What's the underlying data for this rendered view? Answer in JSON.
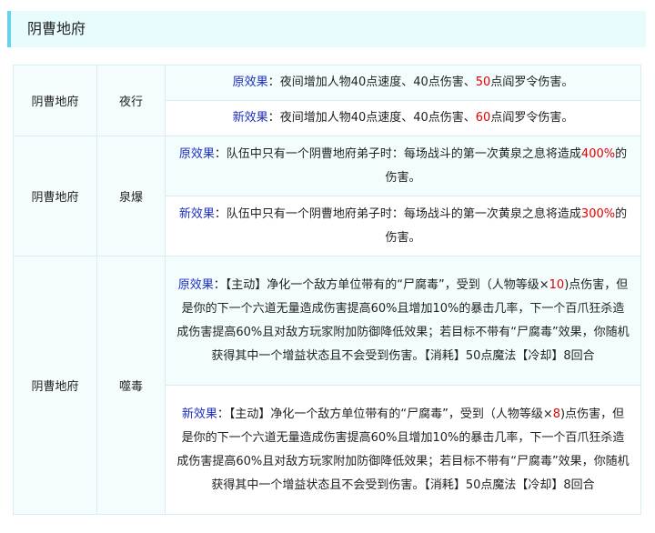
{
  "header": {
    "title": "阴曹地府"
  },
  "colors": {
    "label": "#1f2fbf",
    "highlight": "#e60000",
    "header_accent": "#6ad1ea"
  },
  "rows": [
    {
      "school": "阴曹地府",
      "skill": "夜行",
      "old": {
        "label": "原效果",
        "colon": "：",
        "text_a": "夜间增加人物40点速度、40点伤害、",
        "highlight": "50",
        "text_b": "点阎罗令伤害。"
      },
      "new": {
        "label": "新效果",
        "colon": "：",
        "text_a": "夜间增加人物40点速度、40点伤害、",
        "highlight": "60",
        "text_b": "点阎罗令伤害。"
      }
    },
    {
      "school": "阴曹地府",
      "skill": "泉爆",
      "old": {
        "label": "原效果",
        "colon": "：",
        "text_a": "队伍中只有一个阴曹地府弟子时：每场战斗的第一次黄泉之息将造成",
        "highlight": "400%",
        "text_b": "的伤害。"
      },
      "new": {
        "label": "新效果",
        "colon": "：",
        "text_a": "队伍中只有一个阴曹地府弟子时：每场战斗的第一次黄泉之息将造成",
        "highlight": "300%",
        "text_b": "的伤害。"
      }
    },
    {
      "school": "阴曹地府",
      "skill": "噬毒",
      "old": {
        "label": "原效果",
        "colon": "：",
        "text_a": "【主动】净化一个敌方单位带有的“尸腐毒”，受到（人物等级×",
        "highlight": "10",
        "text_b": ")点伤害，但是你的下一个六道无量造成伤害提高60%且增加10%的暴击几率，下一个百爪狂杀造成伤害提高60%且对敌方玩家附加防御降低效果；若目标不带有“尸腐毒”效果，你随机获得其中一个增益状态且不会受到伤害。【消耗】50点魔法【冷却】8回合"
      },
      "new": {
        "label": "新效果",
        "colon": "：",
        "text_a": "【主动】净化一个敌方单位带有的“尸腐毒”，受到（人物等级×",
        "highlight": "8",
        "text_b": ")点伤害，但是你的下一个六道无量造成伤害提高60%且增加10%的暴击几率，下一个百爪狂杀造成伤害提高60%且对敌方玩家附加防御降低效果；若目标不带有“尸腐毒”效果，你随机获得其中一个增益状态且不会受到伤害。【消耗】50点魔法【冷却】8回合"
      }
    }
  ]
}
